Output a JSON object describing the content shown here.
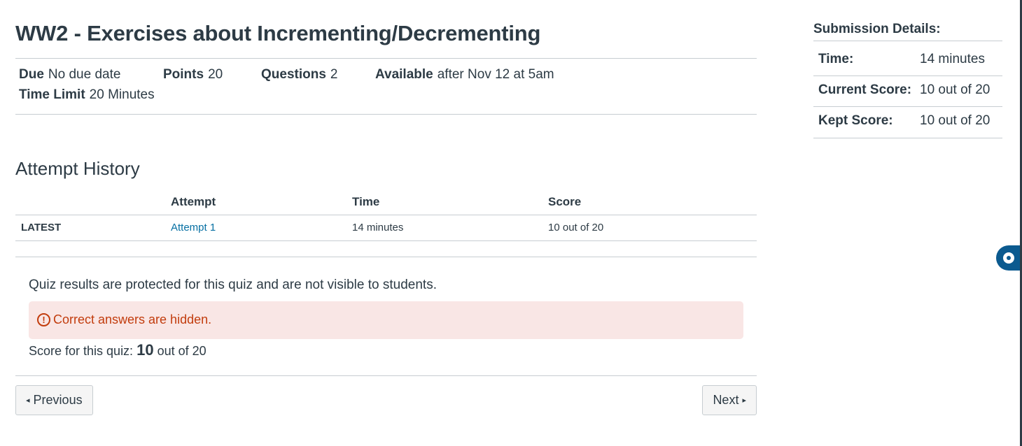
{
  "quiz": {
    "title": "WW2 - Exercises about Incrementing/Decrementing",
    "due_label": "Due",
    "due_value": "No due date",
    "points_label": "Points",
    "points_value": "20",
    "questions_label": "Questions",
    "questions_value": "2",
    "available_label": "Available",
    "available_value": "after Nov 12 at 5am",
    "time_limit_label": "Time Limit",
    "time_limit_value": "20 Minutes"
  },
  "attempt_history": {
    "title": "Attempt History",
    "columns": [
      "",
      "Attempt",
      "Time",
      "Score"
    ],
    "rows": [
      {
        "tag": "LATEST",
        "attempt": "Attempt 1",
        "time": "14 minutes",
        "score": "10 out of 20"
      }
    ]
  },
  "results": {
    "protected_text": "Quiz results are protected for this quiz and are not visible to students.",
    "alert_icon": "!",
    "alert_text": "Correct answers are hidden.",
    "score_prefix": "Score for this quiz:",
    "score_value": "10",
    "score_suffix": "out of 20",
    "alert_color": "#c23c0d"
  },
  "nav": {
    "prev_label": "Previous",
    "next_label": "Next",
    "prev_arrow": "◂",
    "next_arrow": "▸"
  },
  "submission": {
    "title": "Submission Details:",
    "rows": [
      {
        "label": "Time:",
        "value": "14 minutes"
      },
      {
        "label": "Current Score:",
        "value": "10 out of 20"
      },
      {
        "label": "Kept Score:",
        "value": "10 out of 20"
      }
    ]
  }
}
